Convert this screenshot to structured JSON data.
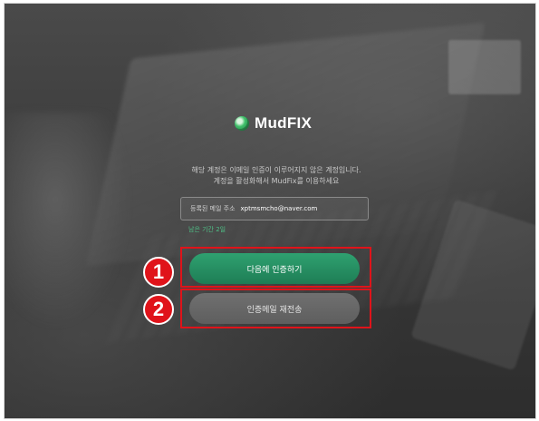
{
  "brand": {
    "name": "MudFIX",
    "icon": "mudfix-logo-icon"
  },
  "message": {
    "line1": "해당 계정은 이메일 인증이 이루어지지 않은 계정입니다.",
    "line2": "계정을 활성화해서 MudFix를 이용하세요"
  },
  "email": {
    "label": "등록된 메일 주소",
    "value": "xptmsmcho@naver.com"
  },
  "remaining": "남은 기간 2일",
  "buttons": {
    "verify_later": "다음에 인증하기",
    "resend": "인증메일 재전송"
  },
  "markers": {
    "first": "1",
    "second": "2"
  },
  "colors": {
    "accent_green": "#2fa170",
    "highlight_red": "#e0131a",
    "secondary_button": "#6a6a6a"
  }
}
